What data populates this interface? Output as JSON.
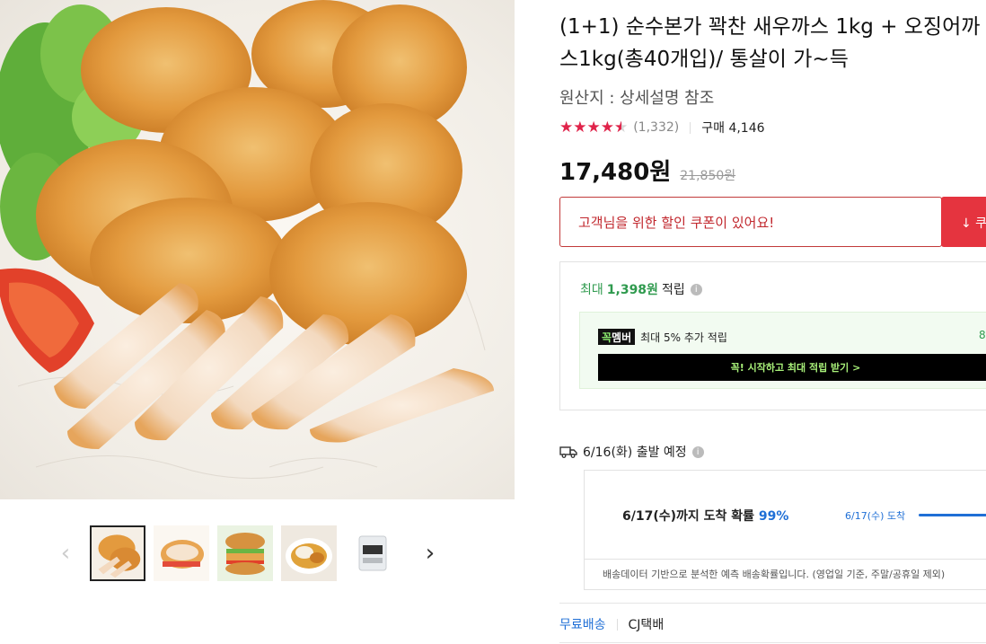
{
  "product": {
    "title": "(1+1) 순수본가 꽉찬 새우까스 1kg + 오징어까스1kg(총40개입)/ 통살이 가~득",
    "origin": "원산지 : 상세설명 참조",
    "rating_stars": 4.5,
    "review_count": "(1,332)",
    "purchase_count": "구매 4,146",
    "price": "17,480원",
    "original_price": "21,850원"
  },
  "coupon": {
    "message": "고객님을 위한 할인 쿠폰이 있어요!",
    "button_label": "↓ 쿠"
  },
  "reward": {
    "prefix": "최대",
    "amount": "1,398원",
    "suffix": "적립",
    "info_icon": "i",
    "member_badge_part1": "꼭",
    "member_badge_part2": "멤버",
    "member_text": "최대 5% 추가 적립",
    "member_right": "8",
    "member_cta": "꼭! 시작하고 최대 적립 받기 >"
  },
  "shipping": {
    "departure": "6/16(화) 출발 예정",
    "info_icon": "i",
    "arrival_prefix": "6/17(수)까지 도착 확률",
    "arrival_pct": "99%",
    "arrival_label": "6/17(수) 도착",
    "note": "배송데이터 기반으로 분석한 예측 배송확률입니다. (영업일 기준, 주말/공휴일 제외)",
    "free_shipping": "무료배송",
    "carrier": "CJ택배"
  },
  "gallery": {
    "prev_arrow": "‹",
    "next_arrow": "›",
    "thumbnails": [
      "thumbnail-cutlets",
      "thumbnail-sandwich",
      "thumbnail-burger",
      "thumbnail-curry-plate",
      "thumbnail-package"
    ],
    "active_index": 0
  },
  "colors": {
    "star": "#e0234a",
    "coupon_border": "#c23a3a",
    "coupon_button": "#e5343f",
    "reward_green": "#2f9a4e",
    "delivery_blue": "#1f6fd6"
  }
}
